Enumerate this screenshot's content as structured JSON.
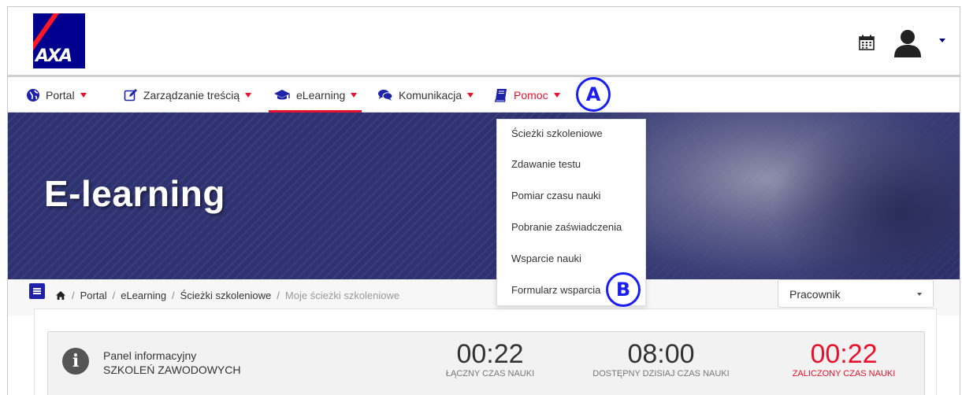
{
  "logo": {
    "text": "AXA"
  },
  "nav": {
    "items": [
      {
        "label": "Portal"
      },
      {
        "label": "Zarządzanie treścią"
      },
      {
        "label": "eLearning"
      },
      {
        "label": "Komunikacja"
      },
      {
        "label": "Pomoc"
      }
    ]
  },
  "hero": {
    "title": "E-learning"
  },
  "dropdown": {
    "items": [
      "Ścieżki szkoleniowe",
      "Zdawanie testu",
      "Pomiar czasu nauki",
      "Pobranie zaświadczenia",
      "Wsparcie nauki",
      "Formularz wsparcia"
    ]
  },
  "breadcrumb": {
    "items": [
      "Portal",
      "eLearning",
      "Ścieżki szkoleniowe",
      "Moje ścieżki szkoleniowe"
    ]
  },
  "role_select": {
    "value": "Pracownik"
  },
  "info_panel": {
    "title_line1": "Panel informacyjny",
    "title_line2": "SZKOLEŃ ZAWODOWYCH",
    "stats": [
      {
        "value": "00:22",
        "label": "ŁĄCZNY CZAS NAUKI"
      },
      {
        "value": "08:00",
        "label": "DOSTĘPNY DZISIAJ CZAS NAUKI"
      },
      {
        "value": "00:22",
        "label": "ZALICZONY CZAS NAUKI"
      }
    ]
  },
  "markers": {
    "a": "A",
    "b": "B"
  },
  "colors": {
    "brand_blue": "#00008f",
    "accent_red": "#e8112d",
    "marker_blue": "#1a1ef0"
  }
}
